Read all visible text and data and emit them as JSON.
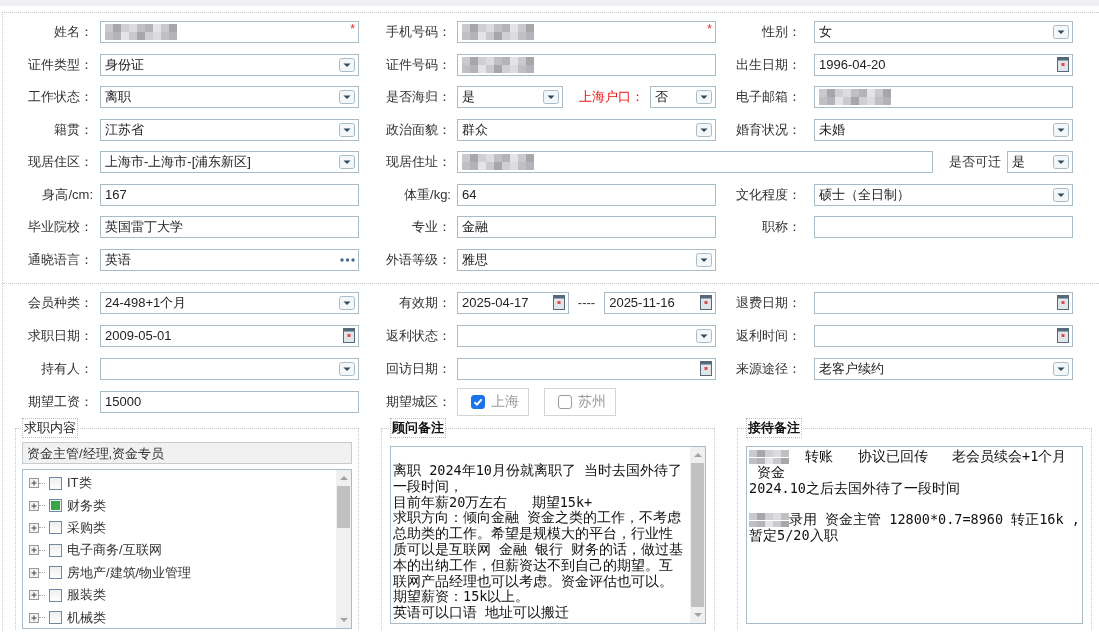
{
  "sections": [
    {
      "rows": [
        {
          "cells": [
            {
              "label": "姓名：",
              "kind": "text",
              "masked": true,
              "required_mark": "*"
            },
            {
              "label": "手机号码：",
              "kind": "text",
              "masked": true,
              "required_mark": "*"
            },
            {
              "label": "性别：",
              "kind": "select",
              "value": "女"
            }
          ]
        },
        {
          "cells": [
            {
              "label": "证件类型：",
              "kind": "select",
              "value": "身份证"
            },
            {
              "label": "证件号码：",
              "kind": "text",
              "masked": true
            },
            {
              "label": "出生日期：",
              "kind": "date",
              "value": "1996-04-20"
            }
          ]
        },
        {
          "cells": [
            {
              "label": "工作状态：",
              "kind": "select",
              "value": "离职"
            },
            {
              "label": "是否海归：",
              "kind": "select",
              "value": "是",
              "trailing": {
                "label": "上海户口：",
                "highlight": true,
                "kind": "select",
                "value": "否"
              }
            },
            {
              "label": "电子邮箱：",
              "kind": "text",
              "masked": true
            }
          ]
        },
        {
          "cells": [
            {
              "label": "籍贯：",
              "kind": "select",
              "value": "江苏省"
            },
            {
              "label": "政治面貌：",
              "kind": "select",
              "value": "群众"
            },
            {
              "label": "婚育状况：",
              "kind": "select",
              "value": "未婚"
            }
          ]
        },
        {
          "cells": [
            {
              "label": "现居住区：",
              "kind": "select",
              "value": "上海市-上海市-[浦东新区]"
            },
            {
              "label": "现居住址：",
              "kind": "text",
              "masked": true,
              "wide": true,
              "trailing": {
                "label": "是否可迁",
                "highlight": false,
                "kind": "select",
                "value": "是"
              }
            }
          ]
        },
        {
          "cells": [
            {
              "label": "身高/cm:",
              "kind": "text",
              "value": "167"
            },
            {
              "label": "体重/kg:",
              "kind": "text",
              "value": "64"
            },
            {
              "label": "文化程度：",
              "kind": "select",
              "value": "硕士（全日制）"
            }
          ]
        },
        {
          "cells": [
            {
              "label": "毕业院校：",
              "kind": "text",
              "value": "英国雷丁大学"
            },
            {
              "label": "专业：",
              "kind": "text",
              "value": "金融"
            },
            {
              "label": "职称：",
              "kind": "text"
            }
          ]
        },
        {
          "cells": [
            {
              "label": "通晓语言：",
              "kind": "lookup",
              "value": "英语"
            },
            {
              "label": "外语等级：",
              "kind": "select",
              "value": "雅思"
            }
          ]
        }
      ]
    },
    {
      "rows": [
        {
          "cells": [
            {
              "label": "会员种类：",
              "kind": "select",
              "value": "24-498+1个月"
            },
            {
              "label": "有效期：",
              "kind": "date",
              "value": "2025-04-17",
              "range": {
                "separator": "----",
                "kind": "date",
                "value": "2025-11-16"
              }
            },
            {
              "label": "退费日期：",
              "kind": "date"
            }
          ]
        },
        {
          "cells": [
            {
              "label": "求职日期：",
              "kind": "date",
              "value": "2009-05-01"
            },
            {
              "label": "返利状态：",
              "kind": "select"
            },
            {
              "label": "返利时间：",
              "kind": "date"
            }
          ]
        },
        {
          "cells": [
            {
              "label": "持有人：",
              "kind": "select"
            },
            {
              "label": "回访日期：",
              "kind": "date"
            },
            {
              "label": "来源途径：",
              "kind": "select",
              "value": "老客户续约"
            }
          ]
        },
        {
          "cells": [
            {
              "label": "期望工资：",
              "kind": "text",
              "value": "15000"
            },
            {
              "label": "期望城区：",
              "kind": "checkgroup",
              "options": [
                {
                  "label": "上海",
                  "checked": true
                },
                {
                  "label": "苏州",
                  "checked": false
                }
              ]
            }
          ]
        }
      ]
    }
  ],
  "panels": [
    {
      "kind": "tree",
      "legend": "求职内容",
      "selection": "资金主管/经理,资金专员",
      "items": [
        {
          "label": "IT类",
          "partial": false,
          "expanded": false
        },
        {
          "label": "财务类",
          "partial": true,
          "expanded": false
        },
        {
          "label": "采购类",
          "partial": false,
          "expanded": false
        },
        {
          "label": "电子商务/互联网",
          "partial": false,
          "expanded": false
        },
        {
          "label": "房地产/建筑/物业管理",
          "partial": false,
          "expanded": false
        },
        {
          "label": "服装类",
          "partial": false,
          "expanded": false
        },
        {
          "label": "机械类",
          "partial": false,
          "expanded": false
        }
      ]
    },
    {
      "kind": "notes",
      "legend": "顾问备注",
      "scrollable": true,
      "paragraphs": [
        [
          {
            "text": "离职 2024年10月份就离职了 当时去国外待了",
            "masked_lead": false
          },
          {
            "text": "一段时间，",
            "masked_lead": false
          },
          {
            "text": "目前年薪20万左右   期望15k+",
            "masked_lead": false
          },
          {
            "text": "求职方向：倾向金融 资金之类的工作，不考虑",
            "masked_lead": false
          },
          {
            "text": "总助类的工作。希望是规模大的平台，行业性",
            "masked_lead": false
          },
          {
            "text": "质可以是互联网 金融 银行 财务的话，做过基",
            "masked_lead": false
          },
          {
            "text": "本的出纳工作，但薪资达不到自己的期望。互",
            "masked_lead": false
          },
          {
            "text": "联网产品经理也可以考虑。资金评估也可以。",
            "masked_lead": false
          },
          {
            "text": "期望薪资：15k以上。",
            "masked_lead": false
          },
          {
            "text": "英语可以口语 地址可以搬迁",
            "masked_lead": false
          }
        ]
      ]
    },
    {
      "kind": "notes",
      "legend": "接待备注",
      "scrollable": false,
      "paragraphs": [
        [
          {
            "text": "  转账   协议已回传   老会员续会+1个月",
            "masked_lead": true
          },
          {
            "text": " 资金",
            "masked_lead": false
          },
          {
            "text": "2024.10之后去国外待了一段时间",
            "masked_lead": false
          }
        ],
        [
          {
            "text": "录用 资金主管 12800*0.7=8960 转正16k ,",
            "masked_lead": true
          },
          {
            "text": "暂定5/20入职",
            "masked_lead": false
          }
        ]
      ]
    }
  ]
}
